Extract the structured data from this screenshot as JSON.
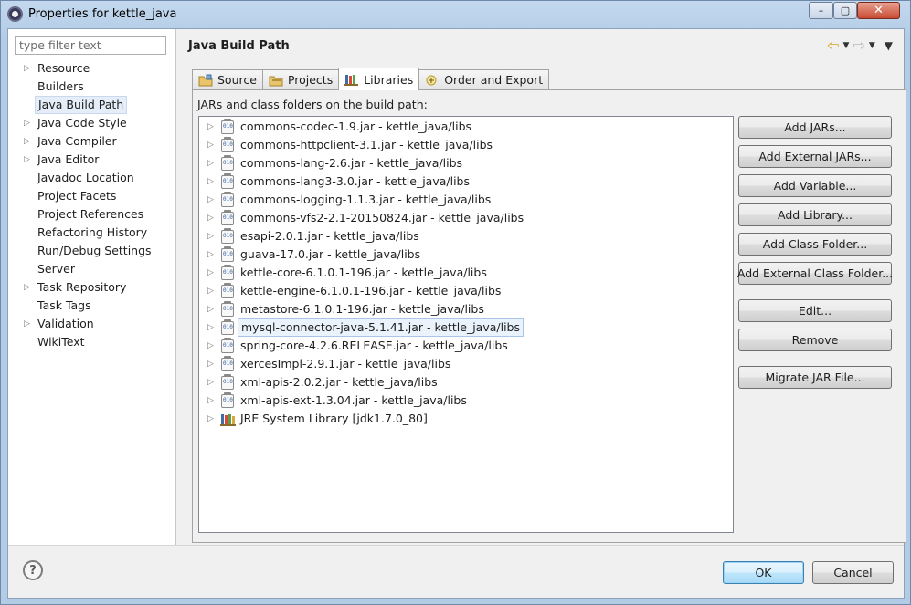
{
  "window": {
    "title": "Properties for kettle_java",
    "controls": {
      "minimize": "–",
      "maximize": "▢",
      "close": "✕"
    }
  },
  "filter": {
    "placeholder": "type filter text"
  },
  "nav_tree": [
    {
      "label": "Resource",
      "expandable": true
    },
    {
      "label": "Builders",
      "expandable": false
    },
    {
      "label": "Java Build Path",
      "expandable": false,
      "selected": true
    },
    {
      "label": "Java Code Style",
      "expandable": true
    },
    {
      "label": "Java Compiler",
      "expandable": true
    },
    {
      "label": "Java Editor",
      "expandable": true
    },
    {
      "label": "Javadoc Location",
      "expandable": false
    },
    {
      "label": "Project Facets",
      "expandable": false
    },
    {
      "label": "Project References",
      "expandable": false
    },
    {
      "label": "Refactoring History",
      "expandable": false
    },
    {
      "label": "Run/Debug Settings",
      "expandable": false
    },
    {
      "label": "Server",
      "expandable": false
    },
    {
      "label": "Task Repository",
      "expandable": true
    },
    {
      "label": "Task Tags",
      "expandable": false
    },
    {
      "label": "Validation",
      "expandable": true
    },
    {
      "label": "WikiText",
      "expandable": false
    }
  ],
  "page": {
    "title": "Java Build Path",
    "back_icon": "back-arrow-icon",
    "forward_icon": "forward-arrow-icon"
  },
  "tabs": [
    {
      "label": "Source",
      "icon": "source-folder-icon",
      "active": false
    },
    {
      "label": "Projects",
      "icon": "projects-icon",
      "active": false
    },
    {
      "label": "Libraries",
      "icon": "libraries-icon",
      "active": true
    },
    {
      "label": "Order and Export",
      "icon": "order-export-icon",
      "active": false
    }
  ],
  "libraries": {
    "caption": "JARs and class folders on the build path:",
    "items": [
      {
        "label": "commons-codec-1.9.jar - kettle_java/libs",
        "type": "jar"
      },
      {
        "label": "commons-httpclient-3.1.jar - kettle_java/libs",
        "type": "jar"
      },
      {
        "label": "commons-lang-2.6.jar - kettle_java/libs",
        "type": "jar"
      },
      {
        "label": "commons-lang3-3.0.jar - kettle_java/libs",
        "type": "jar"
      },
      {
        "label": "commons-logging-1.1.3.jar - kettle_java/libs",
        "type": "jar"
      },
      {
        "label": "commons-vfs2-2.1-20150824.jar - kettle_java/libs",
        "type": "jar"
      },
      {
        "label": "esapi-2.0.1.jar - kettle_java/libs",
        "type": "jar"
      },
      {
        "label": "guava-17.0.jar - kettle_java/libs",
        "type": "jar"
      },
      {
        "label": "kettle-core-6.1.0.1-196.jar - kettle_java/libs",
        "type": "jar"
      },
      {
        "label": "kettle-engine-6.1.0.1-196.jar - kettle_java/libs",
        "type": "jar"
      },
      {
        "label": "metastore-6.1.0.1-196.jar - kettle_java/libs",
        "type": "jar"
      },
      {
        "label": "mysql-connector-java-5.1.41.jar - kettle_java/libs",
        "type": "jar",
        "selected": true
      },
      {
        "label": "spring-core-4.2.6.RELEASE.jar - kettle_java/libs",
        "type": "jar"
      },
      {
        "label": "xercesImpl-2.9.1.jar - kettle_java/libs",
        "type": "jar"
      },
      {
        "label": "xml-apis-2.0.2.jar - kettle_java/libs",
        "type": "jar"
      },
      {
        "label": "xml-apis-ext-1.3.04.jar - kettle_java/libs",
        "type": "jar"
      },
      {
        "label": "JRE System Library [jdk1.7.0_80]",
        "type": "library"
      }
    ]
  },
  "buttons": {
    "add_jars": "Add JARs...",
    "add_external_jars": "Add External JARs...",
    "add_variable": "Add Variable...",
    "add_library": "Add Library...",
    "add_class_folder": "Add Class Folder...",
    "add_external_class_folder": "Add External Class Folder...",
    "edit": "Edit...",
    "remove": "Remove",
    "migrate_jar": "Migrate JAR File..."
  },
  "footer": {
    "help": "?",
    "ok": "OK",
    "cancel": "Cancel"
  }
}
